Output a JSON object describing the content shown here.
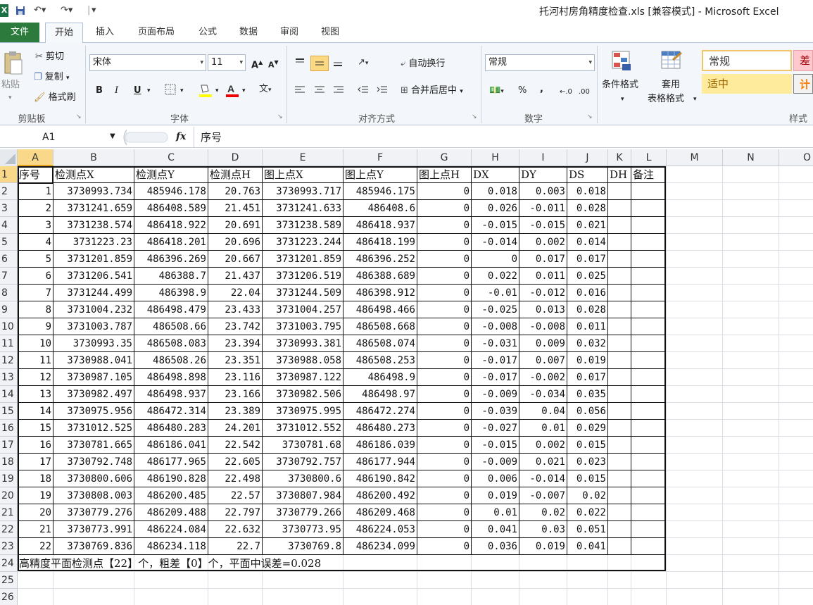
{
  "window": {
    "title": "托河村房角精度检查.xls  [兼容模式]  -  Microsoft Excel"
  },
  "tabs": [
    "文件",
    "开始",
    "插入",
    "页面布局",
    "公式",
    "数据",
    "审阅",
    "视图"
  ],
  "ribbon": {
    "clipboard": {
      "paste": "粘贴",
      "cut": "剪切",
      "copy": "复制",
      "format_painter": "格式刷",
      "label": "剪贴板"
    },
    "font": {
      "name": "宋体",
      "size": "11",
      "bold": "B",
      "italic": "I",
      "underline": "U",
      "label": "字体"
    },
    "alignment": {
      "wrap": "自动换行",
      "merge": "合并后居中",
      "label": "对齐方式"
    },
    "number": {
      "format": "常规",
      "percent": "%",
      "comma": ",",
      "label": "数字"
    },
    "styles": {
      "conditional": "条件格式",
      "table_fmt_1": "套用",
      "table_fmt_2": "表格格式",
      "normal": "常规",
      "bad": "差",
      "neutral": "适中",
      "calc": "计",
      "label": "样式"
    }
  },
  "formula_bar": {
    "name_box": "A1",
    "fx": "fx",
    "formula": "序号"
  },
  "columns": [
    "A",
    "B",
    "C",
    "D",
    "E",
    "F",
    "G",
    "H",
    "I",
    "J",
    "K",
    "L",
    "M",
    "N",
    "O"
  ],
  "row_numbers": [
    "1",
    "2",
    "3",
    "4",
    "5",
    "6",
    "7",
    "8",
    "9",
    "10",
    "11",
    "12",
    "13",
    "14",
    "15",
    "16",
    "17",
    "18",
    "19",
    "20",
    "21",
    "22",
    "23",
    "24",
    "25",
    "26"
  ],
  "sheet": {
    "headers": [
      "序号",
      "检测点X",
      "检测点Y",
      "检测点H",
      "图上点X",
      "图上点Y",
      "图上点H",
      "DX",
      "DY",
      "DS",
      "DH",
      "备注"
    ],
    "rows": [
      [
        "1",
        "3730993.734",
        "485946.178",
        "20.763",
        "3730993.717",
        "485946.175",
        "0",
        "0.018",
        "0.003",
        "0.018"
      ],
      [
        "2",
        "3731241.659",
        "486408.589",
        "21.451",
        "3731241.633",
        "486408.6",
        "0",
        "0.026",
        "-0.011",
        "0.028"
      ],
      [
        "3",
        "3731238.574",
        "486418.922",
        "20.691",
        "3731238.589",
        "486418.937",
        "0",
        "-0.015",
        "-0.015",
        "0.021"
      ],
      [
        "4",
        "3731223.23",
        "486418.201",
        "20.696",
        "3731223.244",
        "486418.199",
        "0",
        "-0.014",
        "0.002",
        "0.014"
      ],
      [
        "5",
        "3731201.859",
        "486396.269",
        "20.667",
        "3731201.859",
        "486396.252",
        "0",
        "0",
        "0.017",
        "0.017"
      ],
      [
        "6",
        "3731206.541",
        "486388.7",
        "21.437",
        "3731206.519",
        "486388.689",
        "0",
        "0.022",
        "0.011",
        "0.025"
      ],
      [
        "7",
        "3731244.499",
        "486398.9",
        "22.04",
        "3731244.509",
        "486398.912",
        "0",
        "-0.01",
        "-0.012",
        "0.016"
      ],
      [
        "8",
        "3731004.232",
        "486498.479",
        "23.433",
        "3731004.257",
        "486498.466",
        "0",
        "-0.025",
        "0.013",
        "0.028"
      ],
      [
        "9",
        "3731003.787",
        "486508.66",
        "23.742",
        "3731003.795",
        "486508.668",
        "0",
        "-0.008",
        "-0.008",
        "0.011"
      ],
      [
        "10",
        "3730993.35",
        "486508.083",
        "23.394",
        "3730993.381",
        "486508.074",
        "0",
        "-0.031",
        "0.009",
        "0.032"
      ],
      [
        "11",
        "3730988.041",
        "486508.26",
        "23.351",
        "3730988.058",
        "486508.253",
        "0",
        "-0.017",
        "0.007",
        "0.019"
      ],
      [
        "12",
        "3730987.105",
        "486498.898",
        "23.116",
        "3730987.122",
        "486498.9",
        "0",
        "-0.017",
        "-0.002",
        "0.017"
      ],
      [
        "13",
        "3730982.497",
        "486498.937",
        "23.166",
        "3730982.506",
        "486498.97",
        "0",
        "-0.009",
        "-0.034",
        "0.035"
      ],
      [
        "14",
        "3730975.956",
        "486472.314",
        "23.389",
        "3730975.995",
        "486472.274",
        "0",
        "-0.039",
        "0.04",
        "0.056"
      ],
      [
        "15",
        "3731012.525",
        "486480.283",
        "24.201",
        "3731012.552",
        "486480.273",
        "0",
        "-0.027",
        "0.01",
        "0.029"
      ],
      [
        "16",
        "3730781.665",
        "486186.041",
        "22.542",
        "3730781.68",
        "486186.039",
        "0",
        "-0.015",
        "0.002",
        "0.015"
      ],
      [
        "17",
        "3730792.748",
        "486177.965",
        "22.605",
        "3730792.757",
        "486177.944",
        "0",
        "-0.009",
        "0.021",
        "0.023"
      ],
      [
        "18",
        "3730800.606",
        "486190.828",
        "22.498",
        "3730800.6",
        "486190.842",
        "0",
        "0.006",
        "-0.014",
        "0.015"
      ],
      [
        "19",
        "3730808.003",
        "486200.485",
        "22.57",
        "3730807.984",
        "486200.492",
        "0",
        "0.019",
        "-0.007",
        "0.02"
      ],
      [
        "20",
        "3730779.276",
        "486209.488",
        "22.797",
        "3730779.266",
        "486209.468",
        "0",
        "0.01",
        "0.02",
        "0.022"
      ],
      [
        "21",
        "3730773.991",
        "486224.084",
        "22.632",
        "3730773.95",
        "486224.053",
        "0",
        "0.041",
        "0.03",
        "0.051"
      ],
      [
        "22",
        "3730769.836",
        "486234.118",
        "22.7",
        "3730769.8",
        "486234.099",
        "0",
        "0.036",
        "0.019",
        "0.041"
      ]
    ],
    "summary": "高精度平面检测点【22】个，粗差【0】个，平面中误差=0.028"
  },
  "colors": {
    "file_tab": "#2d7a3d",
    "selected_header": "#f9d889",
    "ribbon_bg": "#f3f6fa"
  }
}
